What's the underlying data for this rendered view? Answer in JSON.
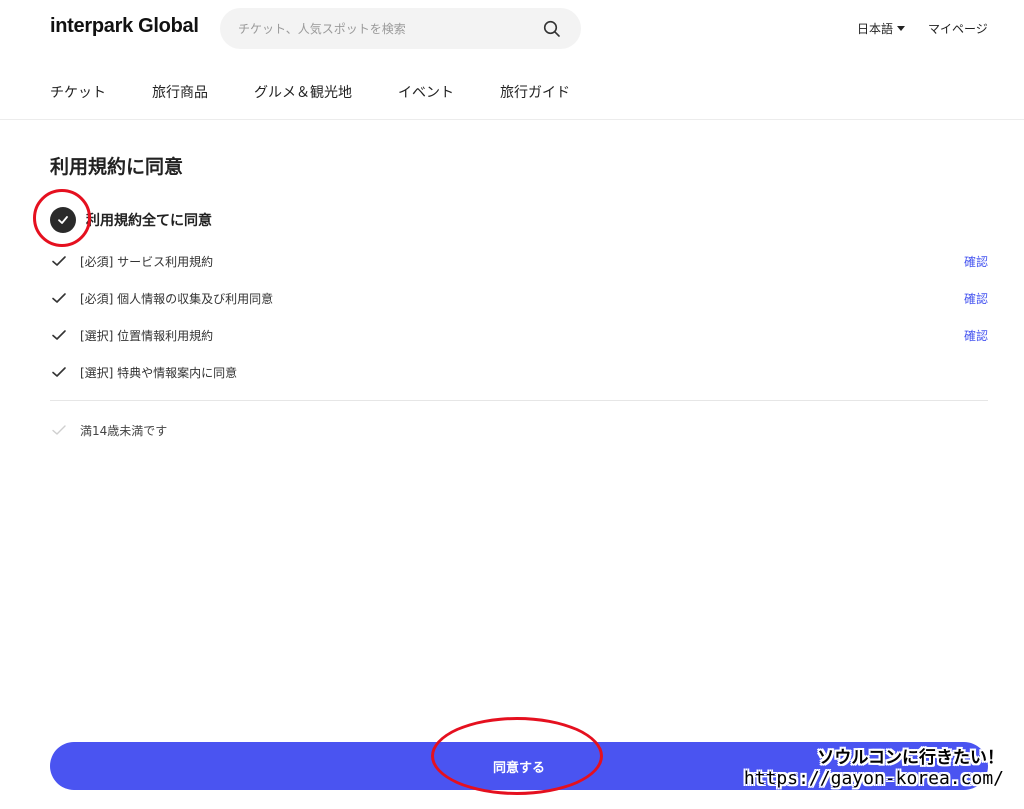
{
  "header": {
    "logo": "interpark Global",
    "search_placeholder": "チケット、人気スポットを検索",
    "language": "日本語",
    "mypage": "マイページ"
  },
  "nav": {
    "items": [
      "チケット",
      "旅行商品",
      "グルメ＆観光地",
      "イベント",
      "旅行ガイド"
    ]
  },
  "main": {
    "title": "利用規約に同意",
    "agree_all_label": "利用規約全てに同意",
    "terms": [
      {
        "label": "[必須] サービス利用規約",
        "link": "確認",
        "checked": true
      },
      {
        "label": "[必須] 個人情報の収集及び利用同意",
        "link": "確認",
        "checked": true
      },
      {
        "label": "[選択] 位置情報利用規約",
        "link": "確認",
        "checked": true
      },
      {
        "label": "[選択] 特典や情報案内に同意",
        "checked": true
      }
    ],
    "age_label": "満14歳未満です",
    "age_checked": false
  },
  "footer": {
    "agree_button": "同意する"
  },
  "watermark": {
    "line1": "ソウルコンに行きたい！",
    "line2": "https://gayon-korea.com/"
  },
  "colors": {
    "accent": "#4a54f1",
    "link": "#4554f0",
    "annotation": "#e5101f"
  }
}
